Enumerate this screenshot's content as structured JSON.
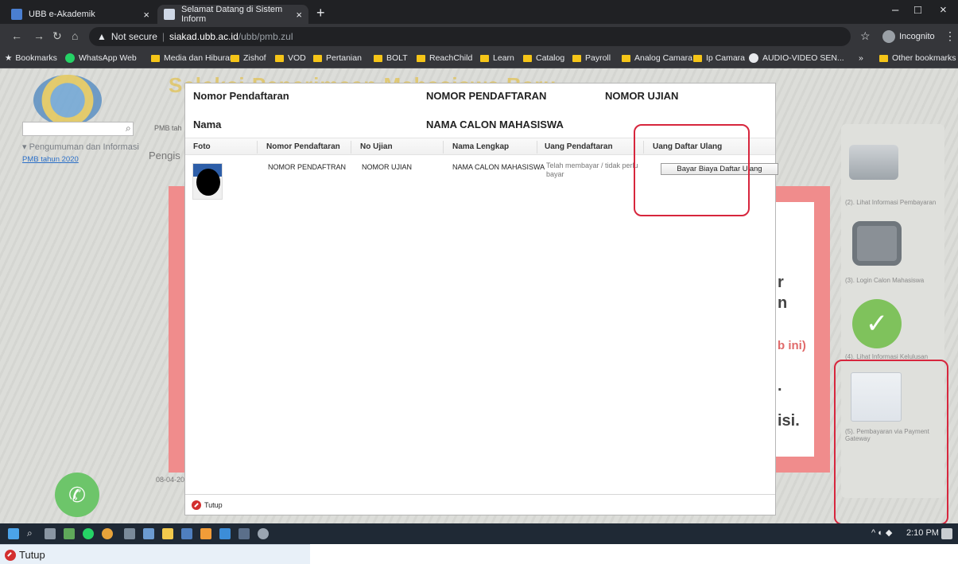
{
  "browser": {
    "tabs": [
      {
        "title": "UBB e-Akademik",
        "favicon": "ubb-favicon",
        "active": false
      },
      {
        "title": "Selamat Datang di Sistem Inform",
        "favicon": "page-favicon",
        "active": true
      }
    ],
    "address": {
      "security": "Not secure",
      "host": "siakad.ubb.ac.id",
      "path": "/ubb/pmb.zul"
    },
    "incognito_label": "Incognito",
    "bookmarks": [
      {
        "label": "Bookmarks",
        "icon": "star-icon"
      },
      {
        "label": "WhatsApp Web",
        "icon": "whatsapp-icon"
      },
      {
        "label": "Media dan Hiburan",
        "icon": "folder-icon"
      },
      {
        "label": "Zishof",
        "icon": "folder-icon"
      },
      {
        "label": "VOD",
        "icon": "folder-icon"
      },
      {
        "label": "Pertanian",
        "icon": "folder-icon"
      },
      {
        "label": "BOLT",
        "icon": "folder-icon"
      },
      {
        "label": "ReachChild",
        "icon": "folder-icon"
      },
      {
        "label": "Learn",
        "icon": "folder-icon"
      },
      {
        "label": "Catalog",
        "icon": "folder-icon"
      },
      {
        "label": "Payroll",
        "icon": "folder-icon"
      },
      {
        "label": "Analog Camara",
        "icon": "folder-icon"
      },
      {
        "label": "Ip Camara",
        "icon": "folder-icon"
      },
      {
        "label": "AUDIO-VIDEO SEN...",
        "icon": "globe-icon"
      }
    ],
    "bookmarks_overflow": "»",
    "other_bookmarks": "Other bookmarks"
  },
  "background_page": {
    "title_fragment": "Seleksi Penerimaan Mahasiswa Baru",
    "side_nav_header": "Pengumuman dan Informasi",
    "side_nav_link": "PMB tahun 2020",
    "crumb": "PMB tah",
    "pengis": "Pengis",
    "date_fragment": "08-04-20",
    "fragments": [
      "r",
      "n",
      "b ini)",
      ".",
      "isi."
    ],
    "right_panel": [
      {
        "label": "(2). Lihat Informasi Pembayaran",
        "icon": "cash-register-icon"
      },
      {
        "label": "(3). Login Calon Mahasiswa",
        "icon": "monitor-user-icon"
      },
      {
        "label": "(4). Lihat Informasi Kelulusan",
        "icon": "checkmark-icon"
      },
      {
        "label": "(5). Pembayaran via Payment Gateway",
        "icon": "pay-card-icon"
      }
    ]
  },
  "modal": {
    "nomor_label": "Nomor Pendaftaran",
    "nomor_value": "NOMOR PENDAFTARAN",
    "ujian_value": "NOMOR UJIAN",
    "nama_label": "Nama",
    "nama_value": "NAMA CALON MAHASISWA",
    "columns": [
      "Foto",
      "Nomor Pendaftaran",
      "No Ujian",
      "Nama Lengkap",
      "Uang Pendaftaran",
      "Uang Daftar Ulang"
    ],
    "row": {
      "nomor": "NOMOR PENDAFTRAN",
      "ujian": "NOMOR UJIAN",
      "nama": "NAMA CALON MAHASISWA",
      "uang_pendaftaran": "Telah membayar / tidak perlu bayar",
      "action_label": "Bayar Biaya Daftar Ulang"
    },
    "close_label": "Tutup"
  },
  "taskbar": {
    "time": "2:10 PM"
  },
  "below_strip": {
    "close_label": "Tutup"
  },
  "colors": {
    "highlight": "#d7263d",
    "red_panel": "#f08c8c",
    "close_icon": "#d32f2f"
  }
}
